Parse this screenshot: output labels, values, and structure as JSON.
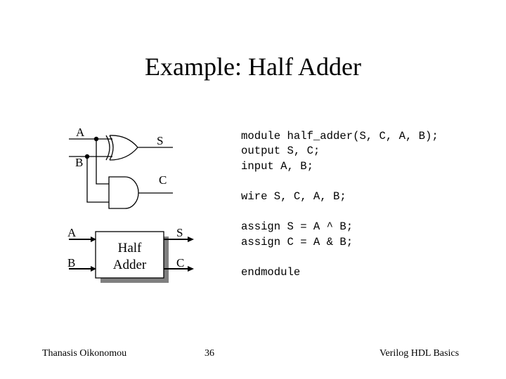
{
  "slide": {
    "title": "Example: Half Adder",
    "gate_diagram": {
      "input_a": "A",
      "input_b": "B",
      "output_s": "S",
      "output_c": "C",
      "gates": [
        "xor-gate",
        "and-gate"
      ]
    },
    "block_diagram": {
      "input_a": "A",
      "input_b": "B",
      "output_s": "S",
      "output_c": "C",
      "box_line1": "Half",
      "box_line2": "Adder"
    },
    "code": {
      "line1": "module half_adder(S, C, A, B);",
      "line2": "output S, C;",
      "line3": "input A, B;",
      "line4": "wire S, C, A, B;",
      "line5": "assign S = A ^ B;",
      "line6": "assign C = A & B;",
      "line7": "endmodule"
    },
    "footer": {
      "author": "Thanasis Oikonomou",
      "page_number": "36",
      "course": "Verilog HDL Basics"
    }
  }
}
